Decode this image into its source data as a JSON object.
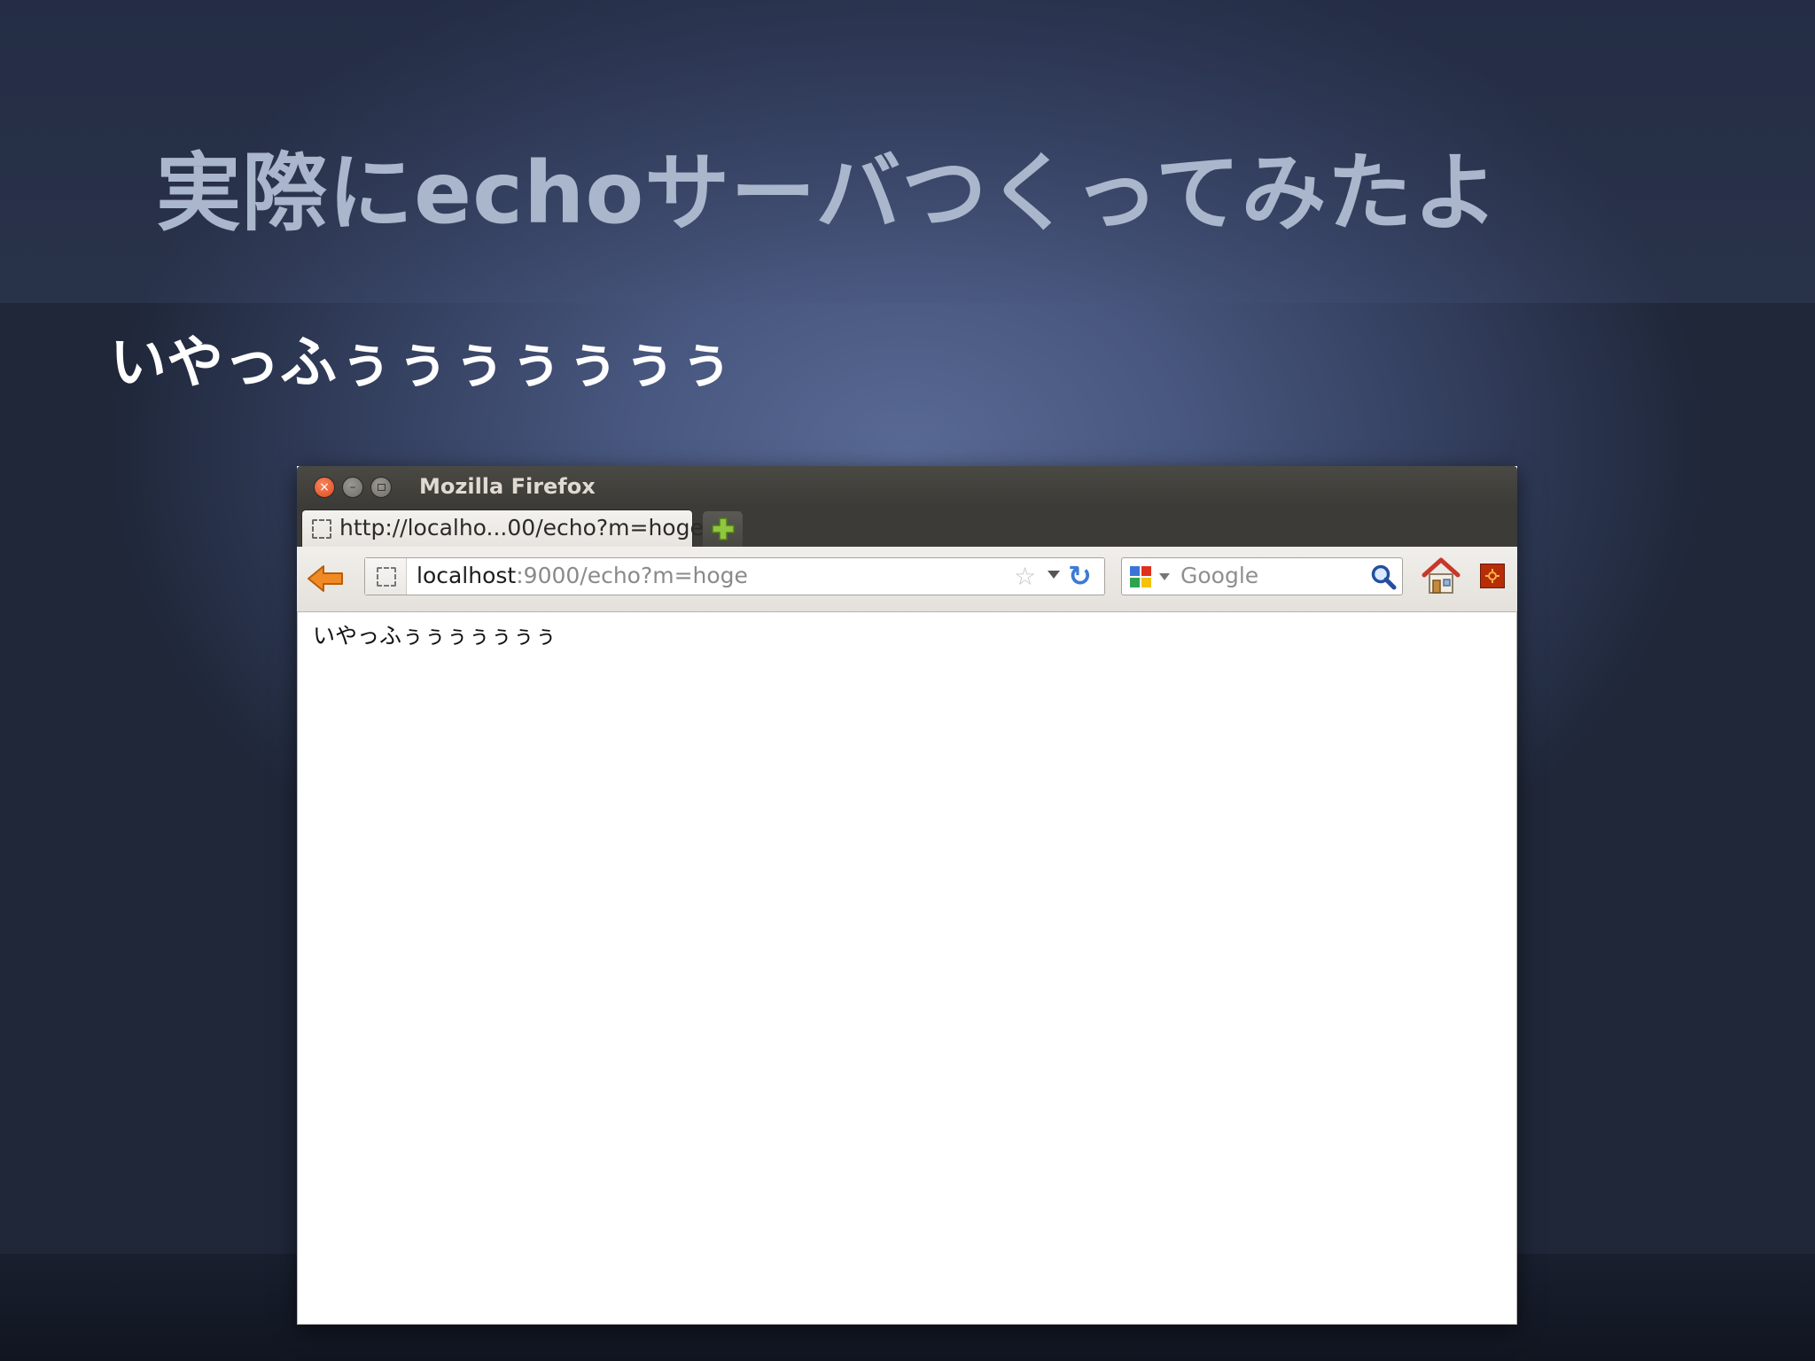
{
  "slide": {
    "title": "実際にechoサーバつくってみたよ",
    "bullet": "いやっふぅぅぅぅぅぅぅ"
  },
  "browser": {
    "window_title": "Mozilla Firefox",
    "tab": {
      "label": "http://localho...00/echo?m=hoge"
    },
    "url": {
      "host": "localhost",
      "rest": ":9000/echo?m=hoge"
    },
    "search": {
      "placeholder": "Google"
    },
    "page_text": "いやっふぅぅぅぅぅぅぅ",
    "icons": {
      "close": "close-icon",
      "minimize": "minimize-icon",
      "maximize": "maximize-icon",
      "new_tab": "plus-icon",
      "back": "back-arrow-icon",
      "bookmark": "star-icon",
      "reload": "reload-icon",
      "search_engine": "google-icon",
      "search_go": "magnifier-icon",
      "home": "home-icon",
      "addon": "addon-icon"
    }
  },
  "colors": {
    "title_text": "#aab6cb",
    "bullet_text": "#ffffff",
    "titlebar": "#3c3b37",
    "close_button": "#df4a1c",
    "new_tab_plus": "#8ec63f",
    "back_arrow": "#f08a24",
    "reload": "#3b7bd6",
    "addon": "#b62d08"
  }
}
